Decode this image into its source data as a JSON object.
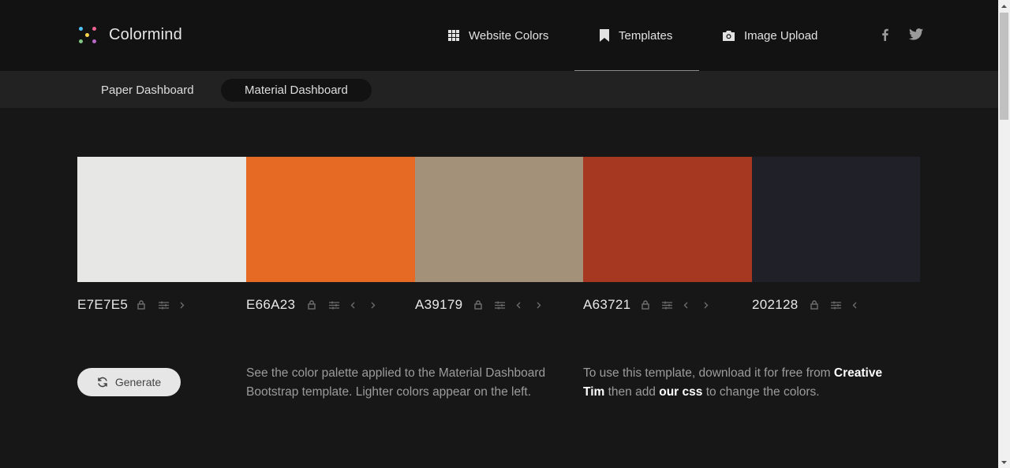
{
  "brand": {
    "name": "Colormind",
    "icon": "colormind-logo-icon"
  },
  "nav": {
    "items": [
      {
        "label": "Website Colors",
        "icon": "grid-icon"
      },
      {
        "label": "Templates",
        "icon": "bookmark-icon",
        "active": true
      },
      {
        "label": "Image Upload",
        "icon": "camera-icon"
      }
    ],
    "social": [
      {
        "icon": "facebook-icon"
      },
      {
        "icon": "twitter-icon"
      }
    ]
  },
  "subnav": {
    "tabs": [
      {
        "label": "Paper Dashboard",
        "active": false
      },
      {
        "label": "Material Dashboard",
        "active": true
      }
    ]
  },
  "palette": [
    {
      "hex": "E7E7E5",
      "color": "#E7E7E5",
      "controls": [
        "lock-icon",
        "adjust-icon",
        "chevron-right-icon"
      ]
    },
    {
      "hex": "E66A23",
      "color": "#E66A23",
      "controls": [
        "lock-icon",
        "adjust-icon",
        "chevron-left-icon",
        "chevron-right-icon"
      ]
    },
    {
      "hex": "A39179",
      "color": "#A39179",
      "controls": [
        "lock-icon",
        "adjust-icon",
        "chevron-left-icon",
        "chevron-right-icon"
      ]
    },
    {
      "hex": "A63721",
      "color": "#A63721",
      "controls": [
        "lock-icon",
        "adjust-icon",
        "chevron-left-icon",
        "chevron-right-icon"
      ]
    },
    {
      "hex": "202128",
      "color": "#202128",
      "controls": [
        "lock-icon",
        "adjust-icon",
        "chevron-left-icon"
      ]
    }
  ],
  "generate": {
    "label": "Generate",
    "icon": "refresh-icon"
  },
  "description": "See the color palette applied to the Material Dashboard Bootstrap template. Lighter colors appear on the left.",
  "usage": {
    "prefix": "To use this template, download it for free from",
    "link1": "Creative Tim",
    "middle": "then add",
    "link2": "our css",
    "suffix": "to change the colors."
  },
  "colors": {
    "header_bg": "#121212",
    "page_bg": "#171717",
    "subnav_bg": "#222222",
    "logo_dots": [
      "#4fc3f7",
      "#f06292",
      "#ffd54f",
      "#81c784",
      "#ba68c8"
    ]
  }
}
